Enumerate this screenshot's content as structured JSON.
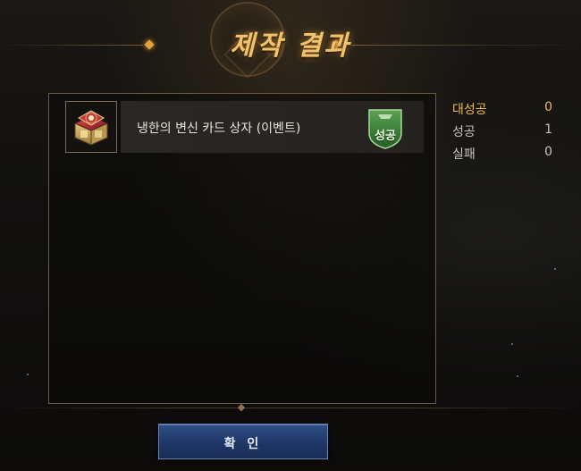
{
  "dialog": {
    "title": "제작 결과"
  },
  "results": [
    {
      "item_name": "냉한의 변신 카드 상자 (이벤트)",
      "icon": "treasure-chest-icon",
      "result_badge": "성공",
      "result_badge_color": "#3d8a3a"
    }
  ],
  "stats": [
    {
      "label": "대성공",
      "value": "0",
      "color": "#f0bb4f"
    },
    {
      "label": "성공",
      "value": "1",
      "color": "#c9c4ba"
    },
    {
      "label": "실패",
      "value": "0",
      "color": "#c9c4ba"
    }
  ],
  "footer": {
    "confirm_label": "확 인"
  },
  "colors": {
    "title": "#f1c26d",
    "accent_gold": "#e0a23a",
    "button_blue": "#1f3768",
    "panel_border": "#6a5a40"
  }
}
